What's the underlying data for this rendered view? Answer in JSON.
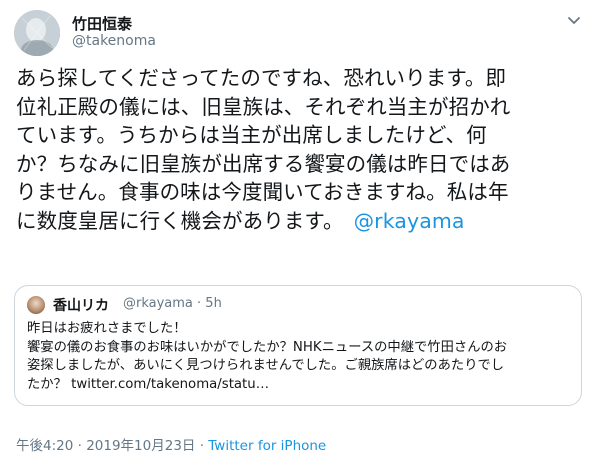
{
  "tweet": {
    "author": {
      "display_name": "竹田恒泰",
      "handle": "@takenoma",
      "avatar_icon": "user-avatar"
    },
    "menu_icon": "chevron-down-icon",
    "text_lines": [
      "あら探してくださってたのですね、恐れいります。即",
      "位礼正殿の儀には、旧皇族は、それぞれ当主が招かれ",
      "ています。うちからは当主が出席しましたけど、何",
      "か？ちなみに旧皇族が出席する饗宴の儀は昨日ではあ",
      "りません。食事の味は今度聞いておきますね。私は年",
      "に数度皇居に行く機会があります。"
    ],
    "mention": "@rkayama",
    "quoted": {
      "display_name": "香山リカ",
      "handle_time": "@rkayama · 5h",
      "text_lines": [
        "昨日はお疲れさまでした！",
        "饗宴の儀のお食事のお味はいかがでしたか？NHKニュースの中継で竹田さんのお",
        "姿探しましたが、あいにく見つけられませんでした。ご親族席はどのあたりでし",
        "たか？ twitter.com/takenoma/statu…"
      ]
    },
    "timestamp": "午後4:20 · 2019年10月23日 · ",
    "client": "Twitter for iPhone"
  },
  "colors": {
    "link": "#1b95e0",
    "secondary_text": "#657786",
    "border": "#ccd6dd"
  }
}
